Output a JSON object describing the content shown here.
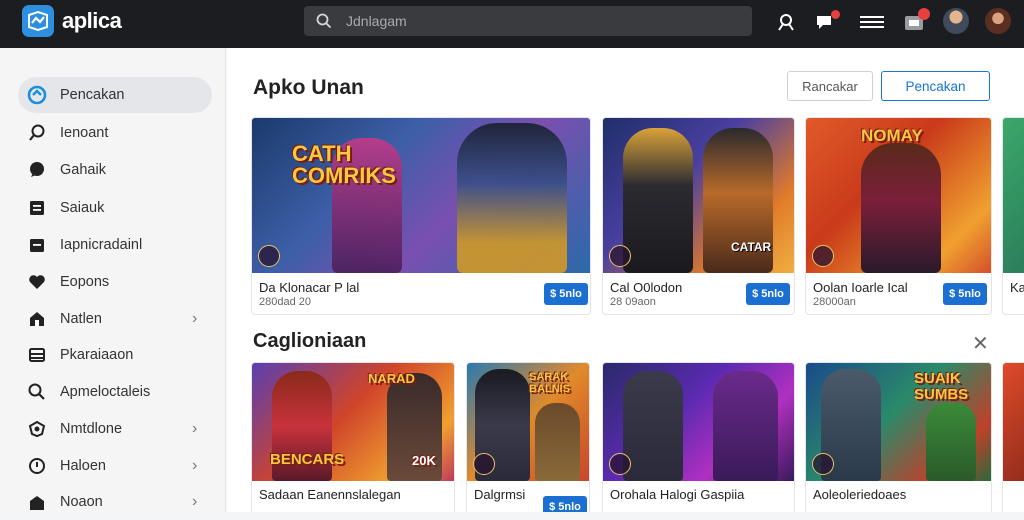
{
  "app": {
    "name": "aplica"
  },
  "search": {
    "placeholder": "Jdnlagam"
  },
  "topbar": {
    "icons": [
      "controller-icon",
      "chat-icon",
      "menu-text-icon",
      "gift-icon"
    ],
    "accent": "#2d8fe0"
  },
  "sidebar": {
    "items": [
      {
        "label": "Pencakan",
        "icon": "compass-icon",
        "active": true,
        "chevron": false
      },
      {
        "label": "Ienoant",
        "icon": "search-icon",
        "chevron": false
      },
      {
        "label": "Gahaik",
        "icon": "chat-bubble-icon",
        "chevron": false
      },
      {
        "label": "Saiauk",
        "icon": "document-icon",
        "chevron": false
      },
      {
        "label": "Iapnicradainl",
        "icon": "folder-icon",
        "chevron": false
      },
      {
        "label": "Eopons",
        "icon": "heart-icon",
        "chevron": false
      },
      {
        "label": "Natlen",
        "icon": "home-icon",
        "chevron": true
      },
      {
        "label": "Pkaraiaaon",
        "icon": "list-icon",
        "chevron": false
      },
      {
        "label": "Apmeloctaleis",
        "icon": "magnifier-icon",
        "chevron": false
      },
      {
        "label": "Nmtdlone",
        "icon": "shield-icon",
        "chevron": true
      },
      {
        "label": "Haloen",
        "icon": "clock-icon",
        "chevron": true
      },
      {
        "label": "Noaon",
        "icon": "building-icon",
        "chevron": true
      }
    ]
  },
  "main": {
    "section1": {
      "title": "Apko Unan",
      "secondary_button": "Rancakar",
      "primary_button": "Pencakan",
      "cards": [
        {
          "poster_text": "CATH COMRIKS",
          "title": "Da Klonacar P lal",
          "subtitle": "280dad 20",
          "price": "$ 5nlo"
        },
        {
          "poster_text": "CATAR",
          "title": "Cal O0lodon",
          "subtitle": "28 09aon",
          "price": "$ 5nlo"
        },
        {
          "poster_text": "NOMAY",
          "title": "Oolan Ioarle Ical",
          "subtitle": "28000an",
          "price": "$ 5nlo"
        },
        {
          "poster_text": "",
          "title": "Ka",
          "subtitle": "",
          "price": ""
        }
      ]
    },
    "section2": {
      "title": "Caglioniaan",
      "close_icon": "close-icon",
      "cards": [
        {
          "poster_text": "NARAD",
          "poster_text2": "BENCARS",
          "poster_text3": "20K",
          "title": "Sadaan Eanennslalegan",
          "subtitle": "",
          "price": ""
        },
        {
          "poster_text": "SARAK BALNIS",
          "title": "Dalgrmsi",
          "subtitle": "",
          "price": "$ 5nlo"
        },
        {
          "poster_text": "",
          "title": "Orohala Halogi Gaspiia",
          "subtitle": "",
          "price": ""
        },
        {
          "poster_text": "SUAIK SUMBS",
          "title": "Aoleoleriedoaes",
          "subtitle": "",
          "price": ""
        }
      ]
    }
  },
  "colors": {
    "topbar": "#1c1d20",
    "primary": "#1a73d9",
    "price_bg": "#1a6fd1"
  }
}
